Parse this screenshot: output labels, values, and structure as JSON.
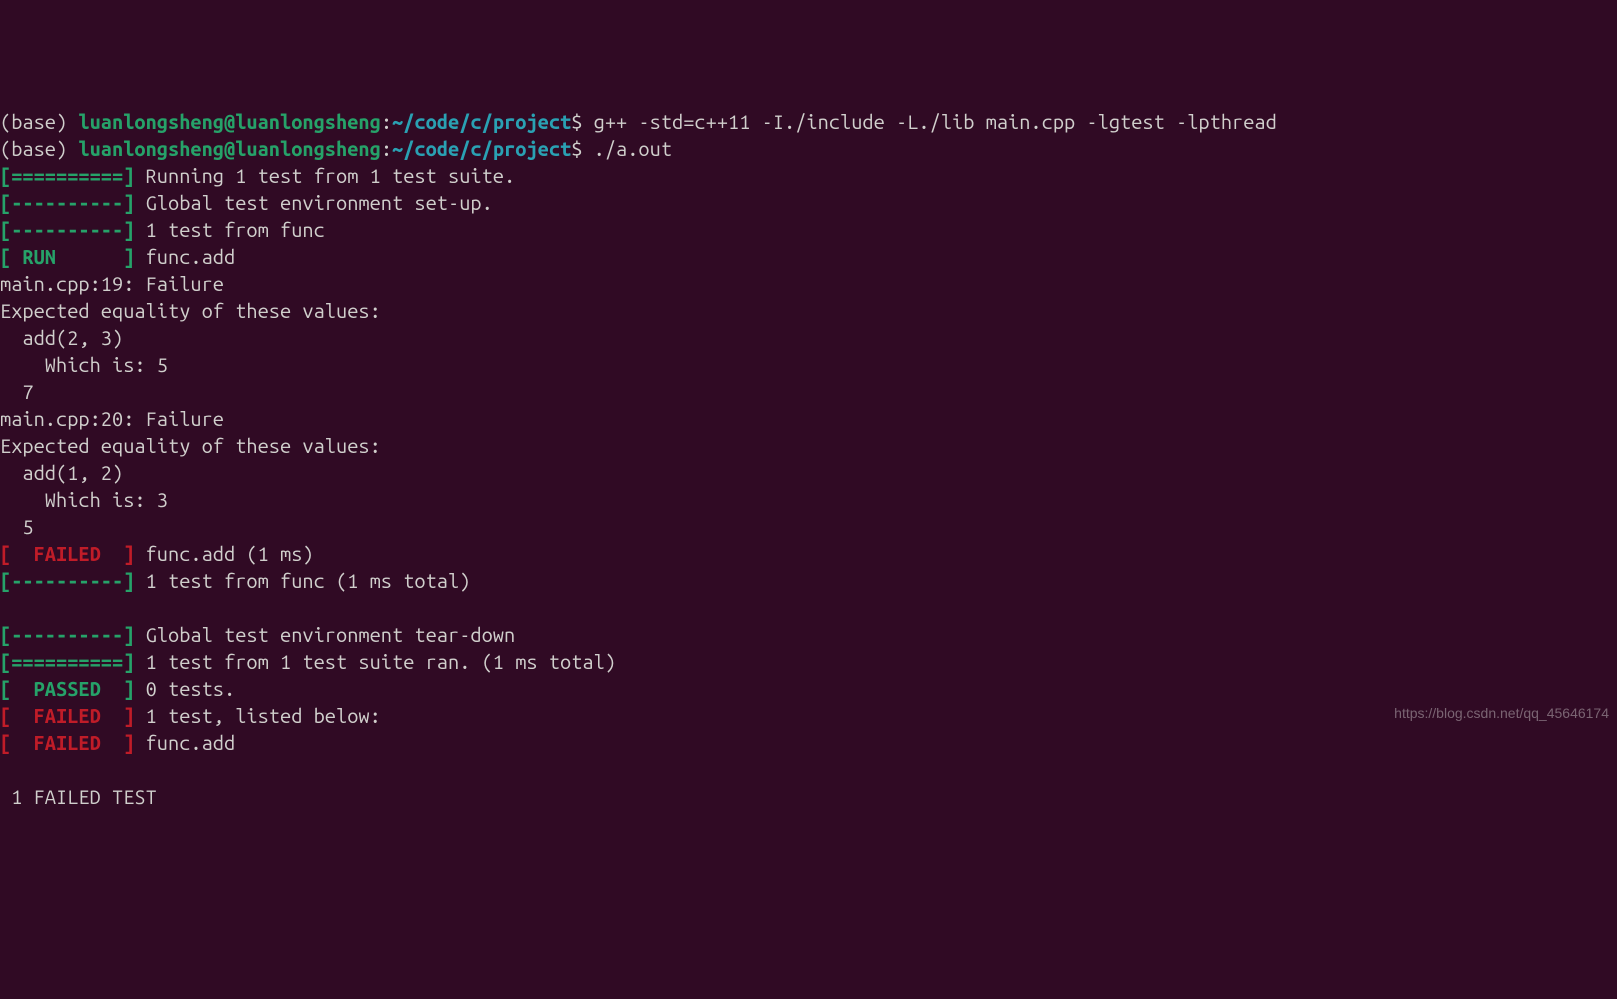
{
  "prompt1": {
    "env": "(base) ",
    "user": "luanlongsheng@luanlongsheng",
    "sep": ":",
    "path": "~/code/c/project",
    "dollar": "$ ",
    "cmd": "g++ -std=c++11 -I./include -L./lib main.cpp -lgtest -lpthread"
  },
  "prompt2": {
    "env": "(base) ",
    "user": "luanlongsheng@luanlongsheng",
    "sep": ":",
    "path": "~/code/c/project",
    "dollar": "$ ",
    "cmd": "./a.out"
  },
  "lines": {
    "l1_tag": "[==========]",
    "l1_txt": " Running 1 test from 1 test suite.",
    "l2_tag": "[----------]",
    "l2_txt": " Global test environment set-up.",
    "l3_tag": "[----------]",
    "l3_txt": " 1 test from func",
    "l4_tag": "[ RUN      ]",
    "l4_txt": " func.add",
    "l5": "main.cpp:19: Failure",
    "l6": "Expected equality of these values:",
    "l7": "  add(2, 3)",
    "l8": "    Which is: 5",
    "l9": "  7",
    "l10": "main.cpp:20: Failure",
    "l11": "Expected equality of these values:",
    "l12": "  add(1, 2)",
    "l13": "    Which is: 3",
    "l14": "  5",
    "l15_tag": "[  FAILED  ]",
    "l15_txt": " func.add (1 ms)",
    "l16_tag": "[----------]",
    "l16_txt": " 1 test from func (1 ms total)",
    "blank": " ",
    "l17_tag": "[----------]",
    "l17_txt": " Global test environment tear-down",
    "l18_tag": "[==========]",
    "l18_txt": " 1 test from 1 test suite ran. (1 ms total)",
    "l19_tag": "[  PASSED  ]",
    "l19_txt": " 0 tests.",
    "l20_tag": "[  FAILED  ]",
    "l20_txt": " 1 test, listed below:",
    "l21_tag": "[  FAILED  ]",
    "l21_txt": " func.add",
    "l22": " 1 FAILED TEST"
  },
  "watermark": "https://blog.csdn.net/qq_45646174"
}
